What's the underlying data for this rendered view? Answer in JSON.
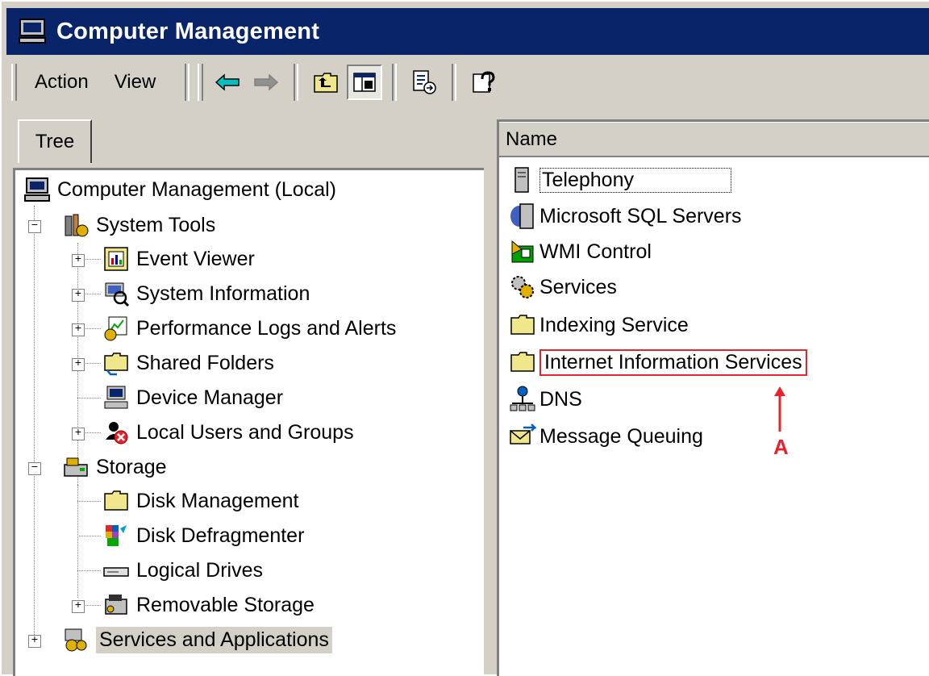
{
  "window": {
    "title": "Computer Management"
  },
  "menu": {
    "action": "Action",
    "view": "View"
  },
  "tree_tab": "Tree",
  "tree": {
    "root": "Computer Management (Local)",
    "system_tools": "System Tools",
    "event_viewer": "Event Viewer",
    "system_information": "System Information",
    "performance_logs": "Performance Logs and Alerts",
    "shared_folders": "Shared Folders",
    "device_manager": "Device Manager",
    "local_users": "Local Users and Groups",
    "storage": "Storage",
    "disk_management": "Disk Management",
    "disk_defragmenter": "Disk Defragmenter",
    "logical_drives": "Logical Drives",
    "removable_storage": "Removable Storage",
    "services_applications": "Services and Applications"
  },
  "list": {
    "column_name": "Name",
    "items": [
      {
        "label": "Telephony",
        "icon": "telephony-icon"
      },
      {
        "label": "Microsoft SQL Servers",
        "icon": "sql-server-icon"
      },
      {
        "label": "WMI Control",
        "icon": "wmi-icon"
      },
      {
        "label": "Services",
        "icon": "services-gear-icon"
      },
      {
        "label": "Indexing Service",
        "icon": "folder-icon"
      },
      {
        "label": "Internet Information Services",
        "icon": "folder-icon"
      },
      {
        "label": "DNS",
        "icon": "dns-network-icon"
      },
      {
        "label": "Message Queuing",
        "icon": "message-queuing-icon"
      }
    ]
  },
  "annotation": {
    "label": "A",
    "color": "#e8232b"
  },
  "colors": {
    "titlebar": "#0a246a",
    "face": "#d4d0c8"
  }
}
